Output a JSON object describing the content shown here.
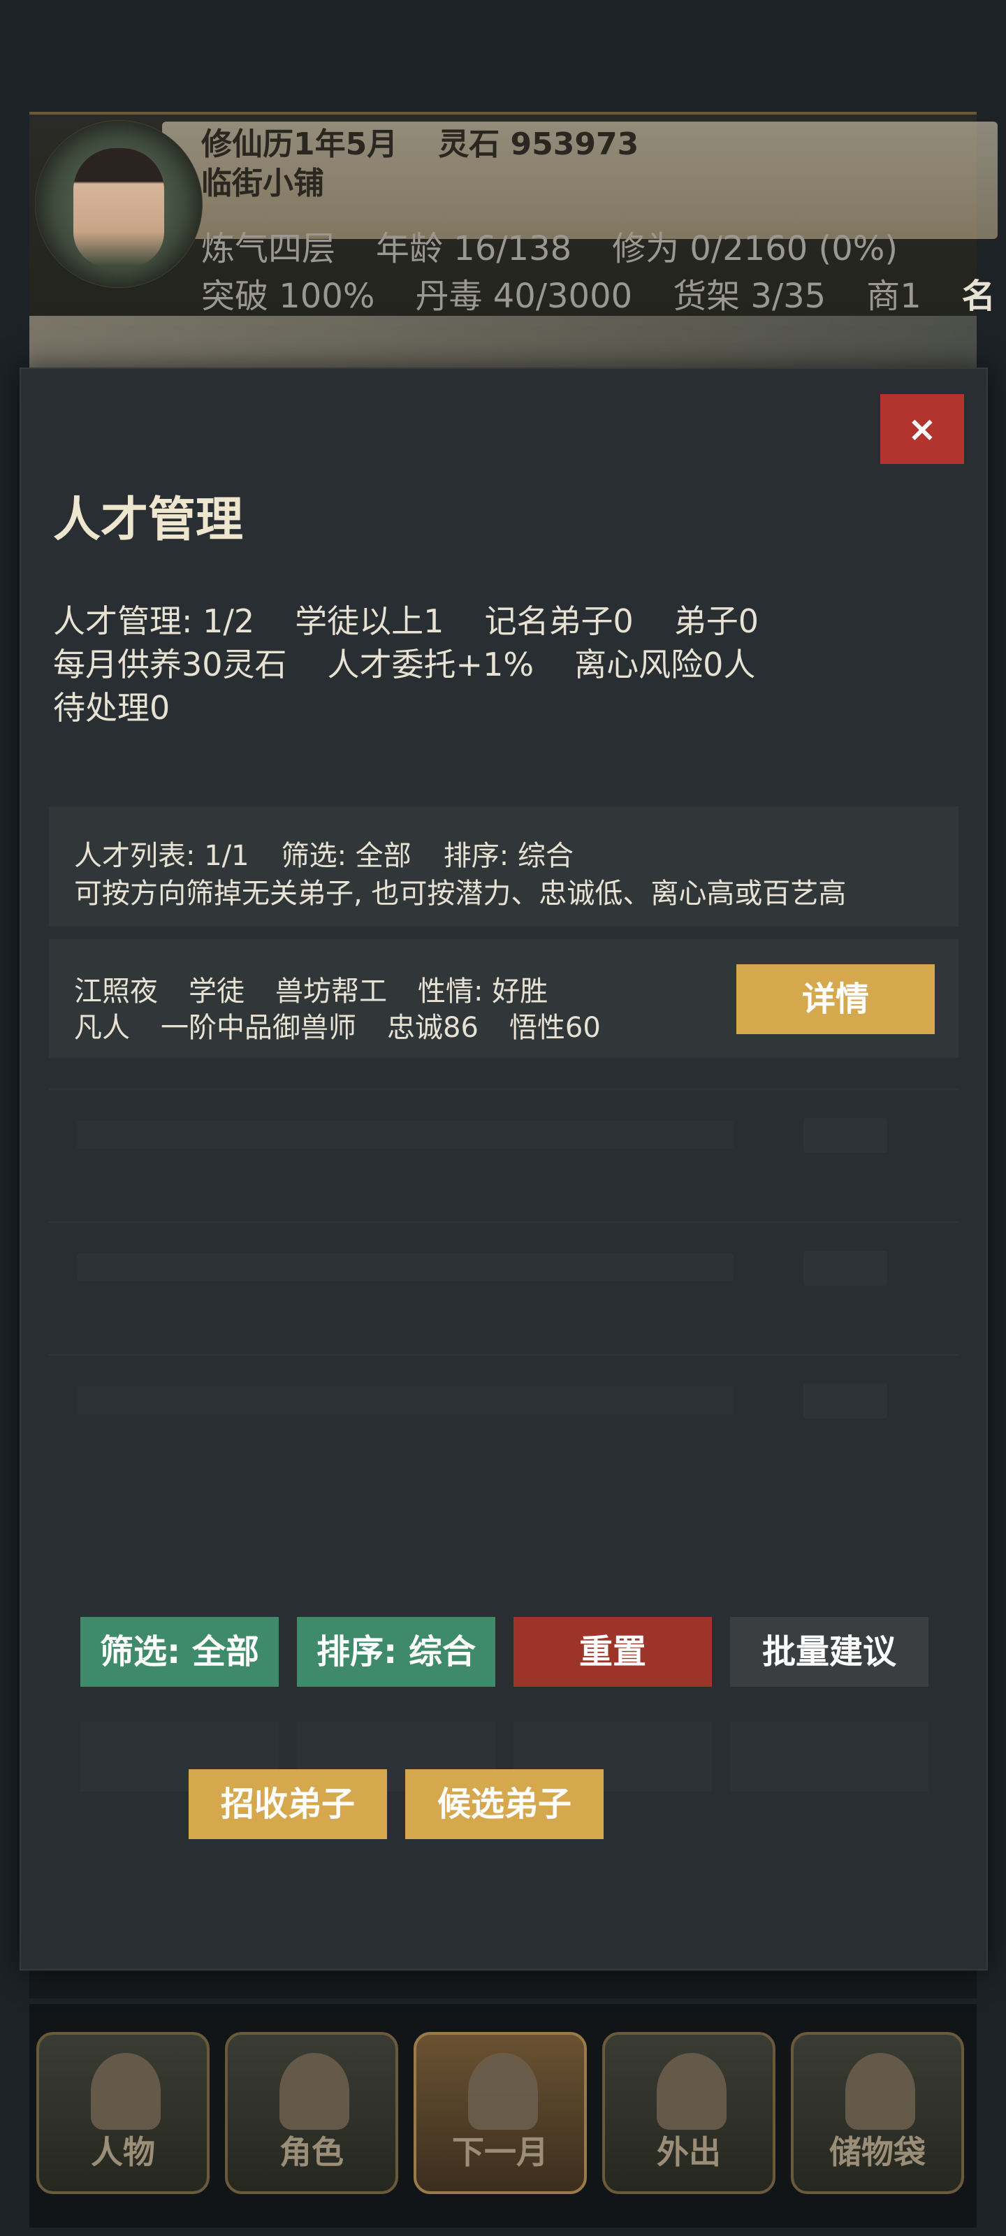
{
  "status": {
    "date": "修仙历1年5月",
    "spirit_stones": "灵石 953973",
    "shop_name": "临街小铺",
    "realm": "炼气四层",
    "age": "年龄 16/138",
    "cultivation": "修为 0/2160 (0%)",
    "breakthrough": "突破 100%",
    "pill_toxicity": "丹毒 40/3000",
    "shelves": "货架 3/35",
    "commerce": "商1",
    "edge_text": "名"
  },
  "modal": {
    "close_label": "×",
    "title": "人才管理",
    "summary": {
      "row1": [
        "人才管理: 1/2",
        "学徒以上1",
        "记名弟子0",
        "弟子0"
      ],
      "row2": [
        "每月供养30灵石",
        "人才委托+1%",
        "离心风险0人"
      ],
      "row3": [
        "待处理0"
      ]
    },
    "list_panel": {
      "items": [
        "人才列表: 1/1",
        "筛选: 全部",
        "排序: 综合"
      ],
      "hint": "可按方向筛掉无关弟子, 也可按潜力、忠诚低、离心高或百艺高"
    },
    "talents": [
      {
        "line1": [
          "江照夜",
          "学徒",
          "兽坊帮工",
          "性情: 好胜"
        ],
        "line2": [
          "凡人",
          "一阶中品御兽师",
          "忠诚86",
          "悟性60"
        ],
        "detail_label": "详情"
      }
    ],
    "actions": {
      "filter": "筛选: 全部",
      "sort": "排序: 综合",
      "reset": "重置",
      "batch": "批量建议",
      "recruit": "招收弟子",
      "candidates": "候选弟子"
    }
  },
  "bottom_nav": [
    {
      "label": "人物",
      "icon": "person-icon"
    },
    {
      "label": "角色",
      "icon": "character-icon"
    },
    {
      "label": "下一月",
      "icon": "flag-icon"
    },
    {
      "label": "外出",
      "icon": "lotus-icon"
    },
    {
      "label": "储物袋",
      "icon": "bag-icon"
    }
  ],
  "colors": {
    "modal_bg": "#282e31",
    "close_red": "#b3342e",
    "gold": "#d5a84e",
    "green": "#3f8a6a",
    "reset_red": "#9c3429"
  }
}
